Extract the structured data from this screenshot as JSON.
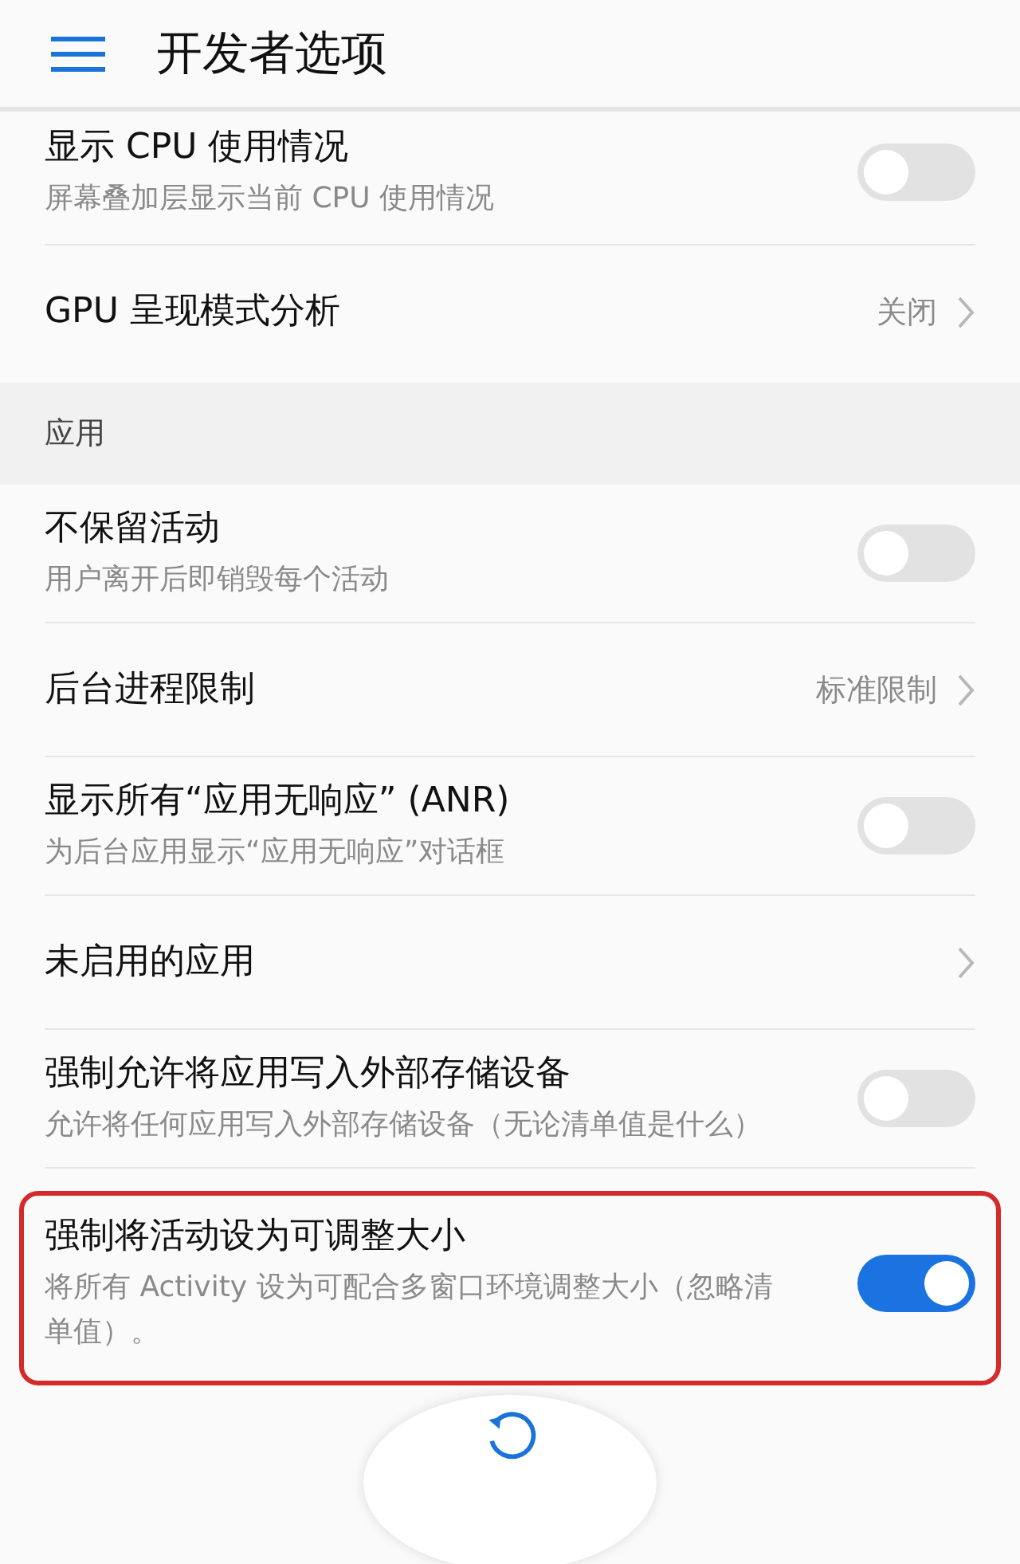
{
  "header": {
    "title": "开发者选项"
  },
  "sections": [
    {
      "items": [
        {
          "kind": "toggle",
          "title": "显示 CPU 使用情况",
          "subtitle": "屏幕叠加层显示当前 CPU 使用情况",
          "on": false,
          "highlighted": false
        },
        {
          "kind": "link",
          "title": "GPU 呈现模式分析",
          "value": "关闭",
          "highlighted": false
        }
      ]
    },
    {
      "header": "应用",
      "items": [
        {
          "kind": "toggle",
          "title": "不保留活动",
          "subtitle": "用户离开后即销毁每个活动",
          "on": false,
          "highlighted": false
        },
        {
          "kind": "link",
          "title": "后台进程限制",
          "value": "标准限制",
          "highlighted": false
        },
        {
          "kind": "toggle",
          "title": "显示所有“应用无响应” (ANR)",
          "subtitle": "为后台应用显示“应用无响应”对话框",
          "on": false,
          "highlighted": false
        },
        {
          "kind": "link",
          "title": "未启用的应用",
          "highlighted": false
        },
        {
          "kind": "toggle",
          "title": "强制允许将应用写入外部存储设备",
          "subtitle": "允许将任何应用写入外部存储设备（无论清单值是什么）",
          "on": false,
          "highlighted": false
        },
        {
          "kind": "toggle",
          "title": "强制将活动设为可调整大小",
          "subtitle": "将所有 Activity 设为可配合多窗口环境调整大小（忽略清单值）。",
          "on": true,
          "highlighted": true
        }
      ]
    }
  ],
  "reset_button": {
    "kind": "floating"
  }
}
